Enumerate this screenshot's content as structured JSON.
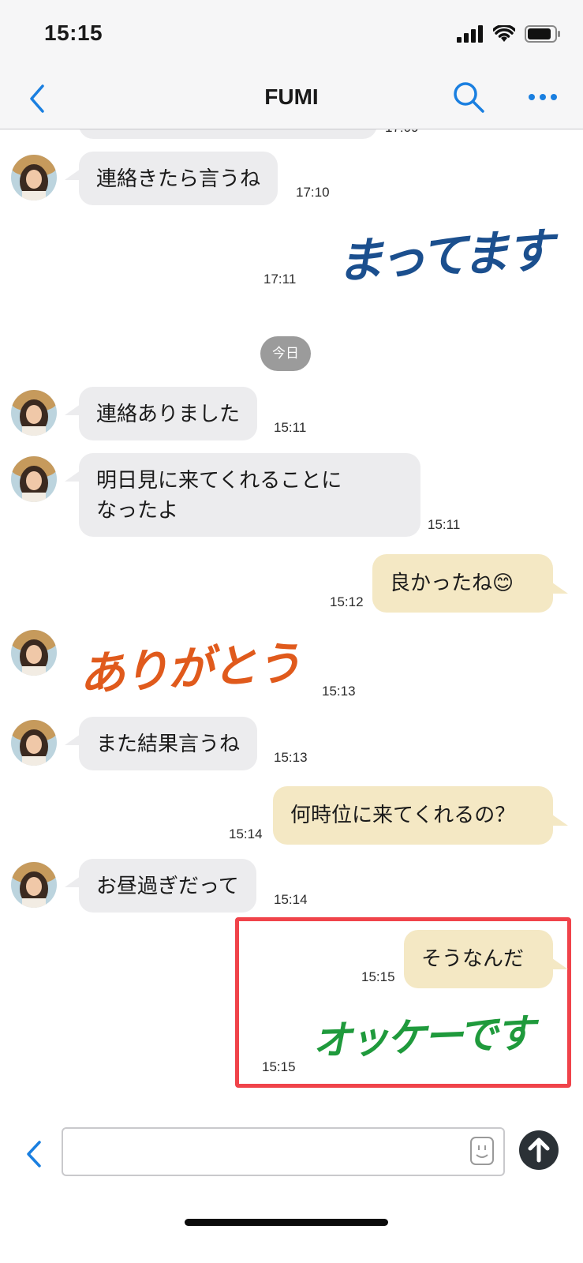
{
  "status_bar": {
    "time": "15:15"
  },
  "nav": {
    "title": "FUMI"
  },
  "chat": {
    "partial_top_time": "17:09",
    "messages": [
      {
        "from": "them",
        "kind": "text",
        "text": "連絡きたら言うね",
        "time": "17:10"
      },
      {
        "from": "me",
        "kind": "sticker",
        "text": "まってます",
        "color": "#1b4f8e",
        "time": "17:11"
      },
      {
        "kind": "date",
        "text": "今日"
      },
      {
        "from": "them",
        "kind": "text",
        "text": "連絡ありました",
        "time": "15:11"
      },
      {
        "from": "them",
        "kind": "text",
        "line1": "明日見に来てくれることに",
        "line2": "なったよ",
        "time": "15:11"
      },
      {
        "from": "me",
        "kind": "text",
        "text": "良かったね😊",
        "time": "15:12"
      },
      {
        "from": "them",
        "kind": "sticker",
        "text": "ありがとう",
        "color": "#e05a1c",
        "time": "15:13"
      },
      {
        "from": "them",
        "kind": "text",
        "text": "また結果言うね",
        "time": "15:13"
      },
      {
        "from": "me",
        "kind": "text",
        "text": "何時位に来てくれるの？",
        "time": "15:14"
      },
      {
        "from": "them",
        "kind": "text",
        "text": "お昼過ぎだって",
        "time": "15:14"
      },
      {
        "from": "me",
        "kind": "text",
        "text": "そうなんだ",
        "time": "15:15"
      },
      {
        "from": "me",
        "kind": "sticker",
        "text": "オッケーです",
        "color": "#1f9a3c",
        "time": "15:15"
      }
    ]
  },
  "colors": {
    "accent": "#1a7fe0",
    "incoming_bubble": "#ececee",
    "outgoing_bubble": "#f4e8c4",
    "highlight": "#f0434a"
  },
  "input": {
    "value": "",
    "placeholder": ""
  }
}
